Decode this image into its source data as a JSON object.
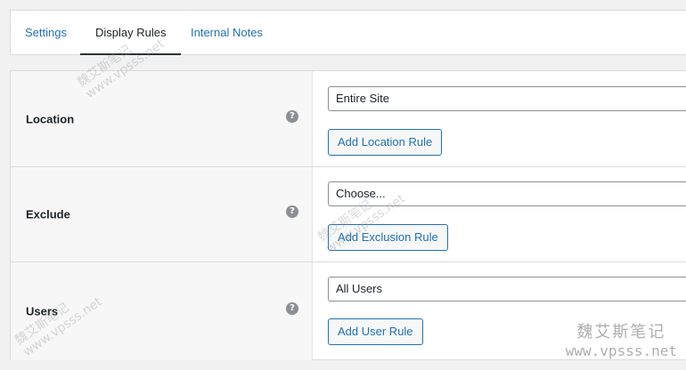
{
  "tabs": [
    {
      "label": "Settings",
      "active": false
    },
    {
      "label": "Display Rules",
      "active": true
    },
    {
      "label": "Internal Notes",
      "active": false
    }
  ],
  "rules": {
    "location": {
      "label": "Location",
      "help": "?",
      "select_value": "Entire Site",
      "button": "Add Location Rule"
    },
    "exclude": {
      "label": "Exclude",
      "help": "?",
      "select_value": "Choose...",
      "button": "Add Exclusion Rule"
    },
    "users": {
      "label": "Users",
      "help": "?",
      "select_value": "All Users",
      "button": "Add User Rule"
    }
  },
  "watermark": {
    "text_cn": "魏艾斯笔记",
    "text_url": "www.vpsss.net"
  },
  "colors": {
    "link": "#2271b1",
    "border": "#dcdcde",
    "label_bg": "#f7f7f7",
    "help_icon": "#8c8f94"
  }
}
